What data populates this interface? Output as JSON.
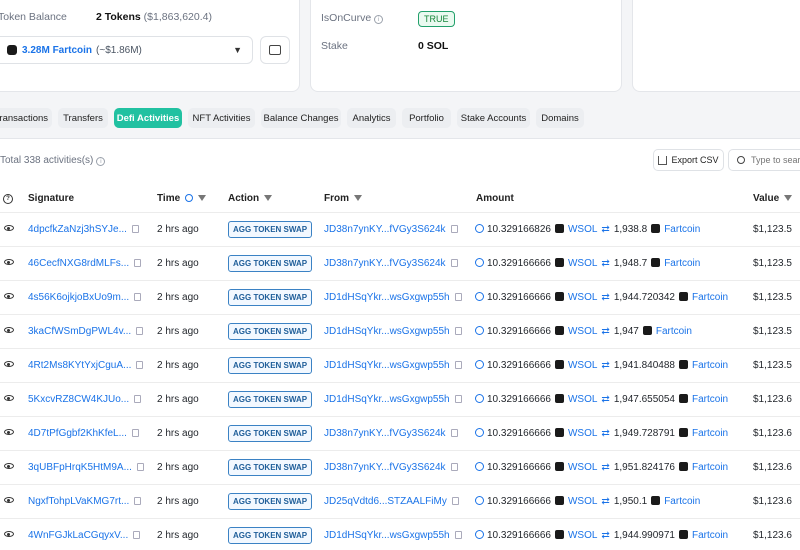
{
  "overview": {
    "token_balance_label": "Token Balance",
    "token_balance_value": "2 Tokens",
    "token_balance_usd": "($1,863,620.4)",
    "dropdown_token": "3.28M Fartcoin",
    "dropdown_usd": "(~$1.86M)",
    "is_on_curve_label": "IsOnCurve",
    "is_on_curve_value": "TRUE",
    "stake_label": "Stake",
    "stake_value": "0 SOL"
  },
  "tabs": [
    {
      "label": "Transactions",
      "active": false
    },
    {
      "label": "Transfers",
      "active": false
    },
    {
      "label": "Defi Activities",
      "active": true
    },
    {
      "label": "NFT Activities",
      "active": false
    },
    {
      "label": "Balance Changes",
      "active": false
    },
    {
      "label": "Analytics",
      "active": false
    },
    {
      "label": "Portfolio",
      "active": false
    },
    {
      "label": "Stake Accounts",
      "active": false
    },
    {
      "label": "Domains",
      "active": false
    }
  ],
  "table": {
    "total_text": "Total 338 activities(s)",
    "export_label": "Export CSV",
    "search_placeholder": "Type to search",
    "headers": {
      "signature": "Signature",
      "time": "Time",
      "action": "Action",
      "from": "From",
      "amount": "Amount",
      "value": "Value"
    },
    "rows": [
      {
        "signature": "4dpcfkZaNzj3hSYJe...",
        "time": "2 hrs ago",
        "action": "AGG TOKEN SWAP",
        "from": "JD38n7ynKY...fVGy3S624k",
        "amount_in": "10.329166826",
        "token_in": "WSOL",
        "amount_out": "1,938.8",
        "token_out": "Fartcoin",
        "value": "$1,123.5"
      },
      {
        "signature": "46CecfNXG8rdMLFs...",
        "time": "2 hrs ago",
        "action": "AGG TOKEN SWAP",
        "from": "JD38n7ynKY...fVGy3S624k",
        "amount_in": "10.329166666",
        "token_in": "WSOL",
        "amount_out": "1,948.7",
        "token_out": "Fartcoin",
        "value": "$1,123.5"
      },
      {
        "signature": "4s56K6ojkjoBxUo9m...",
        "time": "2 hrs ago",
        "action": "AGG TOKEN SWAP",
        "from": "JD1dHSqYkr...wsGxgwp55h",
        "amount_in": "10.329166666",
        "token_in": "WSOL",
        "amount_out": "1,944.720342",
        "token_out": "Fartcoin",
        "value": "$1,123.5"
      },
      {
        "signature": "3kaCfWSmDgPWL4v...",
        "time": "2 hrs ago",
        "action": "AGG TOKEN SWAP",
        "from": "JD1dHSqYkr...wsGxgwp55h",
        "amount_in": "10.329166666",
        "token_in": "WSOL",
        "amount_out": "1,947",
        "token_out": "Fartcoin",
        "value": "$1,123.5"
      },
      {
        "signature": "4Rt2Ms8KYtYxjCguA...",
        "time": "2 hrs ago",
        "action": "AGG TOKEN SWAP",
        "from": "JD1dHSqYkr...wsGxgwp55h",
        "amount_in": "10.329166666",
        "token_in": "WSOL",
        "amount_out": "1,941.840488",
        "token_out": "Fartcoin",
        "value": "$1,123.5"
      },
      {
        "signature": "5KxcvRZ8CW4KJUo...",
        "time": "2 hrs ago",
        "action": "AGG TOKEN SWAP",
        "from": "JD1dHSqYkr...wsGxgwp55h",
        "amount_in": "10.329166666",
        "token_in": "WSOL",
        "amount_out": "1,947.655054",
        "token_out": "Fartcoin",
        "value": "$1,123.6"
      },
      {
        "signature": "4D7tPfGgbf2KhKfeL...",
        "time": "2 hrs ago",
        "action": "AGG TOKEN SWAP",
        "from": "JD38n7ynKY...fVGy3S624k",
        "amount_in": "10.329166666",
        "token_in": "WSOL",
        "amount_out": "1,949.728791",
        "token_out": "Fartcoin",
        "value": "$1,123.6"
      },
      {
        "signature": "3qUBFpHrqK5HtM9A...",
        "time": "2 hrs ago",
        "action": "AGG TOKEN SWAP",
        "from": "JD38n7ynKY...fVGy3S624k",
        "amount_in": "10.329166666",
        "token_in": "WSOL",
        "amount_out": "1,951.824176",
        "token_out": "Fartcoin",
        "value": "$1,123.6"
      },
      {
        "signature": "NgxfTohpLVaKMG7rt...",
        "time": "2 hrs ago",
        "action": "AGG TOKEN SWAP",
        "from": "JD25qVdtd6...STZAALFiMy",
        "amount_in": "10.329166666",
        "token_in": "WSOL",
        "amount_out": "1,950.1",
        "token_out": "Fartcoin",
        "value": "$1,123.6"
      },
      {
        "signature": "4WnFGJkLaCGqyxV...",
        "time": "2 hrs ago",
        "action": "AGG TOKEN SWAP",
        "from": "JD1dHSqYkr...wsGxgwp55h",
        "amount_in": "10.329166666",
        "token_in": "WSOL",
        "amount_out": "1,944.990971",
        "token_out": "Fartcoin",
        "value": "$1,123.6"
      }
    ]
  }
}
